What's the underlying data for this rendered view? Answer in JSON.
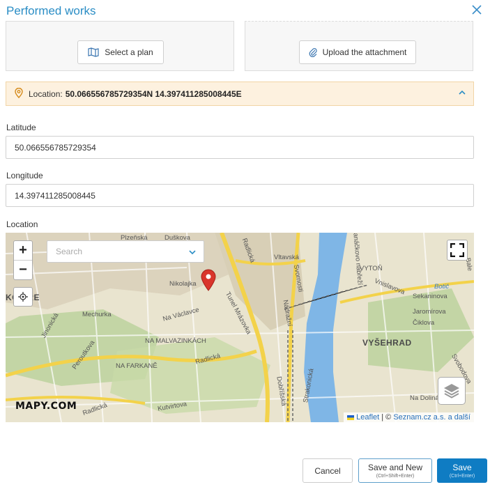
{
  "dialog": {
    "title": "Performed works",
    "close_icon": "close-icon"
  },
  "cards": {
    "select_plan_label": "Select a plan",
    "upload_label": "Upload the attachment"
  },
  "location_bar": {
    "label": "Location:",
    "value": "50.066556785729354N 14.397411285008445E"
  },
  "fields": {
    "latitude_label": "Latitude",
    "latitude_value": "50.066556785729354",
    "longitude_label": "Longitude",
    "longitude_value": "14.397411285008445",
    "location_label": "Location"
  },
  "map": {
    "zoom_in": "+",
    "zoom_out": "−",
    "search_placeholder": "Search",
    "logo": "MAPY.COM",
    "attribution_leaflet": "Leaflet",
    "attribution_sep": " | © ",
    "attribution_provider": "Seznam.cz a.s. a další",
    "labels": {
      "l1": "Plzeňská",
      "l2": "Duškova",
      "l3": "Nikolajka",
      "l4": "Tunel Mrázovka",
      "l5": "Radlická",
      "l6": "Vltavská",
      "l7": "Svornosti",
      "l8": "Nádražní",
      "l9": "Janáčkovo nábřeží",
      "l10": "VYTOŇ",
      "l11": "Vnislavova",
      "l12": "Sekaninova",
      "l13": "Jaromírova",
      "l14": "Čiklova",
      "l15": "VYŠEHRAD",
      "l16": "Mechurka",
      "l17": "Na Václavce",
      "l18": "Jinonická",
      "l19": "NA MALVAZINKÁCH",
      "l20": "Peroutkova",
      "l21": "NA FARKANĚ",
      "l22": "Radlická",
      "l23": "Dobříšská",
      "l24": "Strakonická",
      "l25": "Kutvirtova",
      "l26": "Radlická",
      "l27": "Na Dolinách",
      "l28": "KOŠÍŘE",
      "l29": "Botič",
      "l30": "Svobodova",
      "l31": "Bale"
    }
  },
  "footer": {
    "cancel": "Cancel",
    "save_new": "Save and New",
    "save_new_hint": "(Ctrl+Shift+Enter)",
    "save": "Save",
    "save_hint": "(Ctrl+Enter)"
  },
  "colors": {
    "accent": "#2a8dc5",
    "primary_button": "#0f7cc3",
    "warning_bg": "#fdf1df",
    "marker": "#d9352c"
  }
}
